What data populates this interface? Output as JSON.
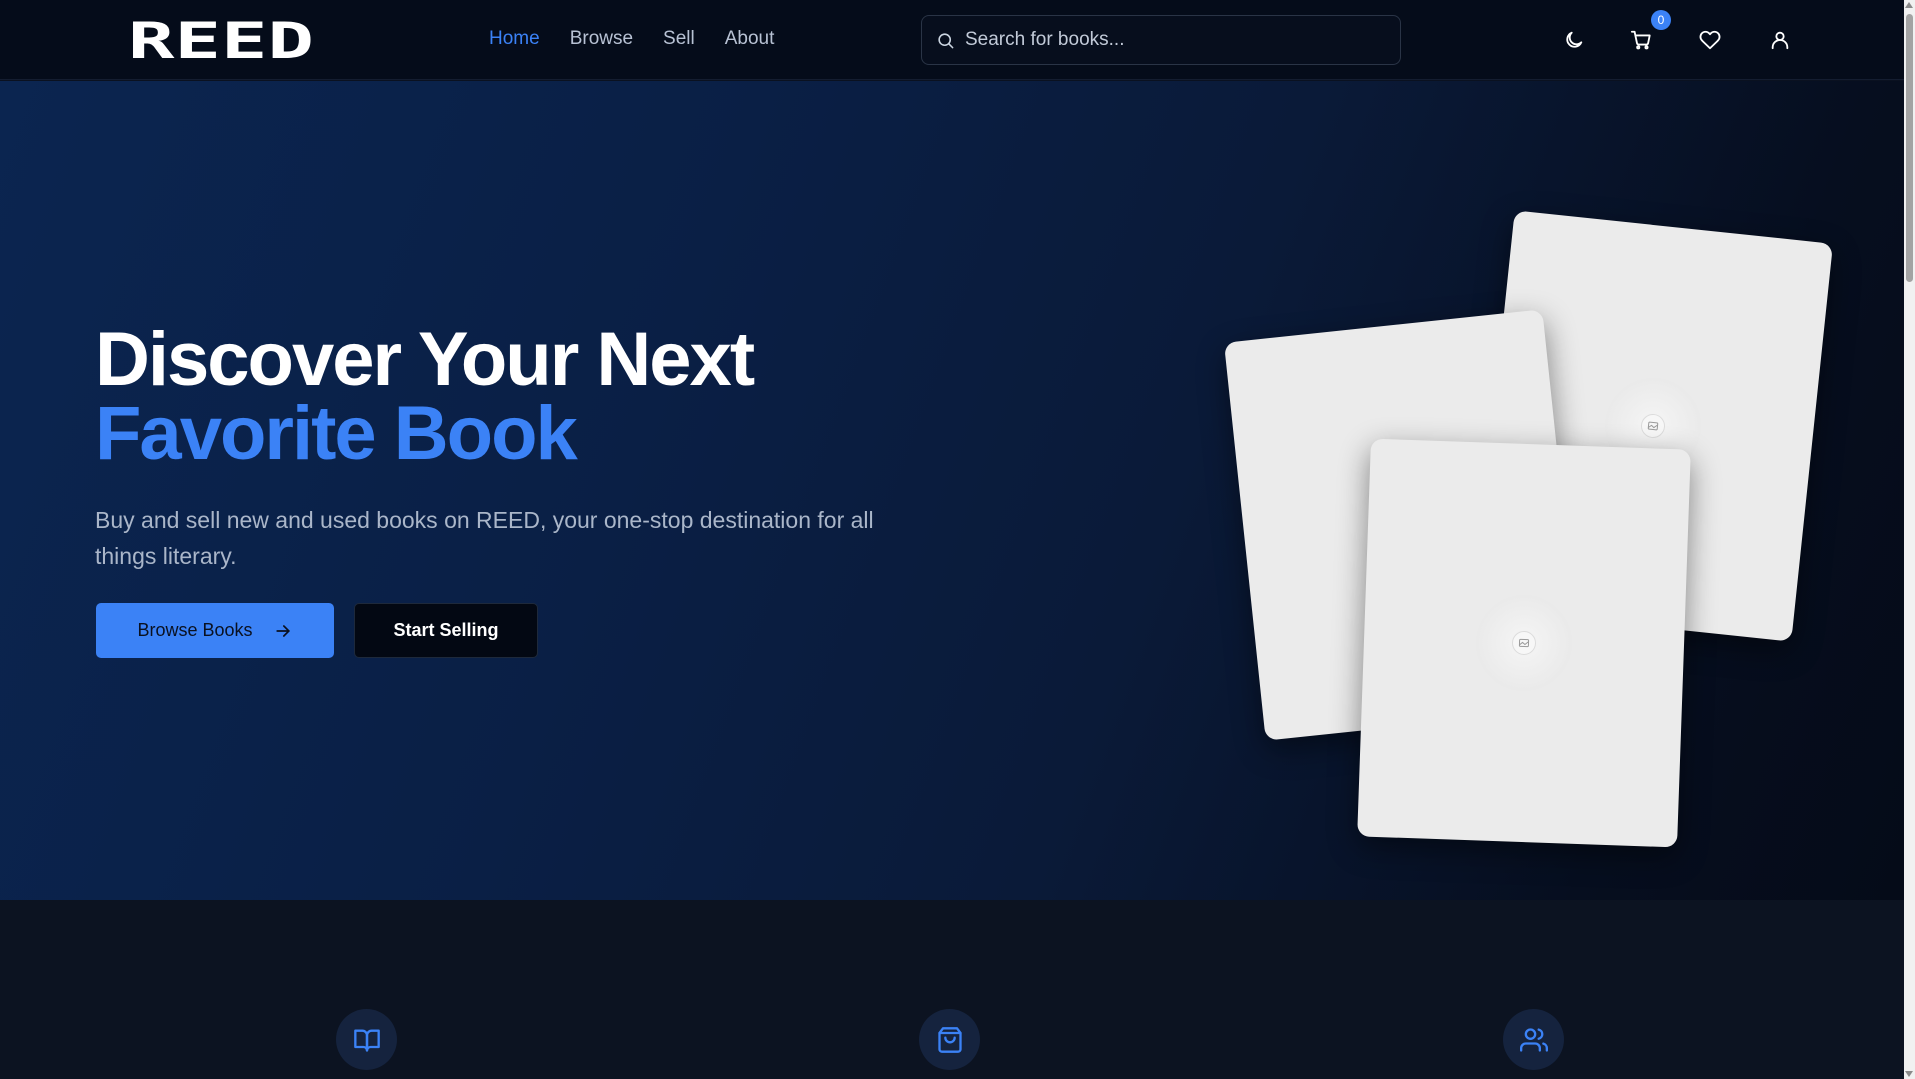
{
  "header": {
    "logo_text": "REED",
    "nav": [
      {
        "label": "Home",
        "active": true
      },
      {
        "label": "Browse",
        "active": false
      },
      {
        "label": "Sell",
        "active": false
      },
      {
        "label": "About",
        "active": false
      }
    ],
    "search_placeholder": "Search for books...",
    "cart_count": "0",
    "icons": [
      "moon-icon",
      "cart-icon",
      "heart-icon",
      "user-icon"
    ]
  },
  "hero": {
    "title_line1": "Discover Your Next",
    "title_line2": "Favorite Book",
    "subtitle": "Buy and sell new and used books on REED, your one-stop destination for all things literary.",
    "primary_button": "Browse Books",
    "secondary_button": "Start Selling"
  },
  "features": {
    "icons": [
      "book-open-icon",
      "shopping-bag-icon",
      "users-icon"
    ]
  },
  "colors": {
    "accent": "#3b82f6",
    "header_bg": "#050c1a",
    "hero_bg_start": "#0b2550",
    "hero_bg_end": "#050b18",
    "features_bg": "#0c1321"
  }
}
